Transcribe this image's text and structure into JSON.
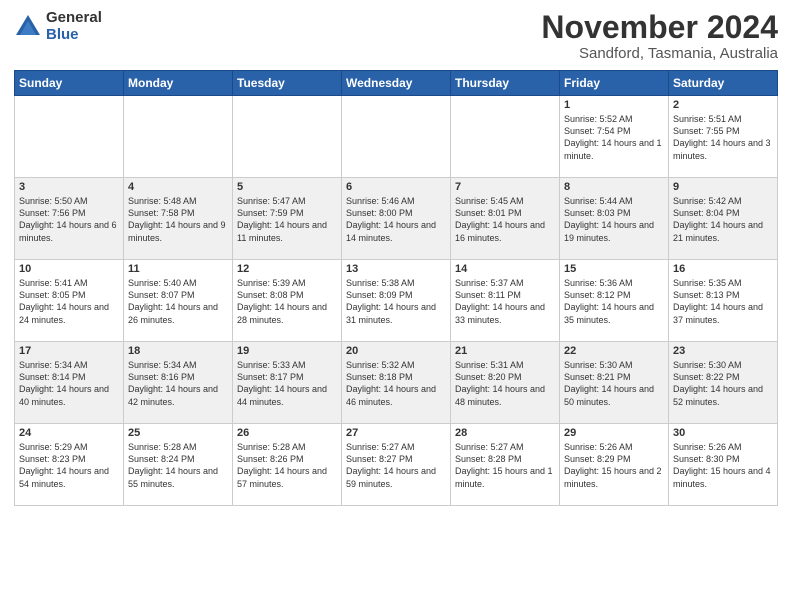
{
  "logo": {
    "general": "General",
    "blue": "Blue"
  },
  "title": "November 2024",
  "location": "Sandford, Tasmania, Australia",
  "weekdays": [
    "Sunday",
    "Monday",
    "Tuesday",
    "Wednesday",
    "Thursday",
    "Friday",
    "Saturday"
  ],
  "weeks": [
    [
      {
        "day": "",
        "info": ""
      },
      {
        "day": "",
        "info": ""
      },
      {
        "day": "",
        "info": ""
      },
      {
        "day": "",
        "info": ""
      },
      {
        "day": "",
        "info": ""
      },
      {
        "day": "1",
        "info": "Sunrise: 5:52 AM\nSunset: 7:54 PM\nDaylight: 14 hours and 1 minute."
      },
      {
        "day": "2",
        "info": "Sunrise: 5:51 AM\nSunset: 7:55 PM\nDaylight: 14 hours and 3 minutes."
      }
    ],
    [
      {
        "day": "3",
        "info": "Sunrise: 5:50 AM\nSunset: 7:56 PM\nDaylight: 14 hours and 6 minutes."
      },
      {
        "day": "4",
        "info": "Sunrise: 5:48 AM\nSunset: 7:58 PM\nDaylight: 14 hours and 9 minutes."
      },
      {
        "day": "5",
        "info": "Sunrise: 5:47 AM\nSunset: 7:59 PM\nDaylight: 14 hours and 11 minutes."
      },
      {
        "day": "6",
        "info": "Sunrise: 5:46 AM\nSunset: 8:00 PM\nDaylight: 14 hours and 14 minutes."
      },
      {
        "day": "7",
        "info": "Sunrise: 5:45 AM\nSunset: 8:01 PM\nDaylight: 14 hours and 16 minutes."
      },
      {
        "day": "8",
        "info": "Sunrise: 5:44 AM\nSunset: 8:03 PM\nDaylight: 14 hours and 19 minutes."
      },
      {
        "day": "9",
        "info": "Sunrise: 5:42 AM\nSunset: 8:04 PM\nDaylight: 14 hours and 21 minutes."
      }
    ],
    [
      {
        "day": "10",
        "info": "Sunrise: 5:41 AM\nSunset: 8:05 PM\nDaylight: 14 hours and 24 minutes."
      },
      {
        "day": "11",
        "info": "Sunrise: 5:40 AM\nSunset: 8:07 PM\nDaylight: 14 hours and 26 minutes."
      },
      {
        "day": "12",
        "info": "Sunrise: 5:39 AM\nSunset: 8:08 PM\nDaylight: 14 hours and 28 minutes."
      },
      {
        "day": "13",
        "info": "Sunrise: 5:38 AM\nSunset: 8:09 PM\nDaylight: 14 hours and 31 minutes."
      },
      {
        "day": "14",
        "info": "Sunrise: 5:37 AM\nSunset: 8:11 PM\nDaylight: 14 hours and 33 minutes."
      },
      {
        "day": "15",
        "info": "Sunrise: 5:36 AM\nSunset: 8:12 PM\nDaylight: 14 hours and 35 minutes."
      },
      {
        "day": "16",
        "info": "Sunrise: 5:35 AM\nSunset: 8:13 PM\nDaylight: 14 hours and 37 minutes."
      }
    ],
    [
      {
        "day": "17",
        "info": "Sunrise: 5:34 AM\nSunset: 8:14 PM\nDaylight: 14 hours and 40 minutes."
      },
      {
        "day": "18",
        "info": "Sunrise: 5:34 AM\nSunset: 8:16 PM\nDaylight: 14 hours and 42 minutes."
      },
      {
        "day": "19",
        "info": "Sunrise: 5:33 AM\nSunset: 8:17 PM\nDaylight: 14 hours and 44 minutes."
      },
      {
        "day": "20",
        "info": "Sunrise: 5:32 AM\nSunset: 8:18 PM\nDaylight: 14 hours and 46 minutes."
      },
      {
        "day": "21",
        "info": "Sunrise: 5:31 AM\nSunset: 8:20 PM\nDaylight: 14 hours and 48 minutes."
      },
      {
        "day": "22",
        "info": "Sunrise: 5:30 AM\nSunset: 8:21 PM\nDaylight: 14 hours and 50 minutes."
      },
      {
        "day": "23",
        "info": "Sunrise: 5:30 AM\nSunset: 8:22 PM\nDaylight: 14 hours and 52 minutes."
      }
    ],
    [
      {
        "day": "24",
        "info": "Sunrise: 5:29 AM\nSunset: 8:23 PM\nDaylight: 14 hours and 54 minutes."
      },
      {
        "day": "25",
        "info": "Sunrise: 5:28 AM\nSunset: 8:24 PM\nDaylight: 14 hours and 55 minutes."
      },
      {
        "day": "26",
        "info": "Sunrise: 5:28 AM\nSunset: 8:26 PM\nDaylight: 14 hours and 57 minutes."
      },
      {
        "day": "27",
        "info": "Sunrise: 5:27 AM\nSunset: 8:27 PM\nDaylight: 14 hours and 59 minutes."
      },
      {
        "day": "28",
        "info": "Sunrise: 5:27 AM\nSunset: 8:28 PM\nDaylight: 15 hours and 1 minute."
      },
      {
        "day": "29",
        "info": "Sunrise: 5:26 AM\nSunset: 8:29 PM\nDaylight: 15 hours and 2 minutes."
      },
      {
        "day": "30",
        "info": "Sunrise: 5:26 AM\nSunset: 8:30 PM\nDaylight: 15 hours and 4 minutes."
      }
    ]
  ]
}
